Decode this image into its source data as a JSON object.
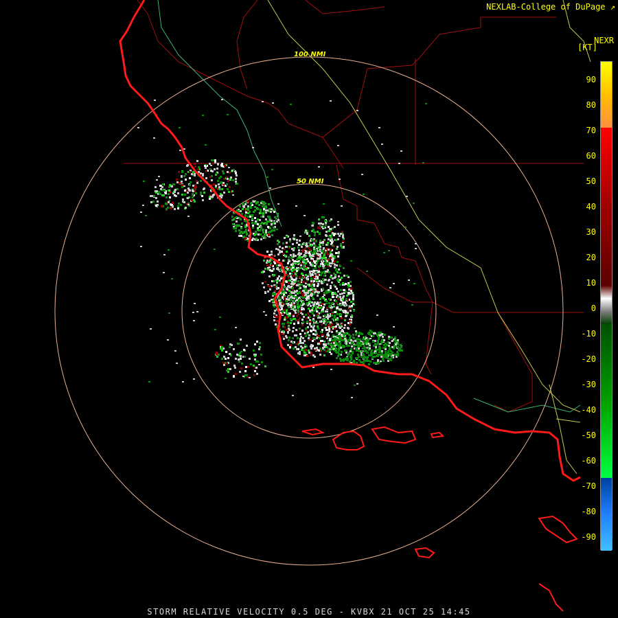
{
  "credit": "NEXLAB-College of DuPage",
  "credit_icon": "external-link-icon",
  "legend": {
    "product": "NEXR",
    "unit": "[KT]",
    "ticks": [
      "90",
      "80",
      "70",
      "60",
      "50",
      "40",
      "30",
      "20",
      "10",
      "0",
      "-10",
      "-20",
      "-30",
      "-40",
      "-50",
      "-60",
      "-70",
      "-80",
      "-90"
    ]
  },
  "rings": {
    "outer_label": "100 NMI",
    "inner_label": "50 NMI"
  },
  "caption": "STORM RELATIVE VELOCITY 0.5 DEG - KVBX 21 OCT 25 14:45",
  "colors": {
    "coastline": "#ff1a1a",
    "state_borders": "#a01010",
    "range_rings": "#e8b090",
    "highway_yellow": "#c8c850",
    "highway_green": "#3cb371",
    "outbound_red": "#8b0000",
    "inbound_green": "#0a8a0a",
    "near_zero": "#c8c8c8"
  }
}
